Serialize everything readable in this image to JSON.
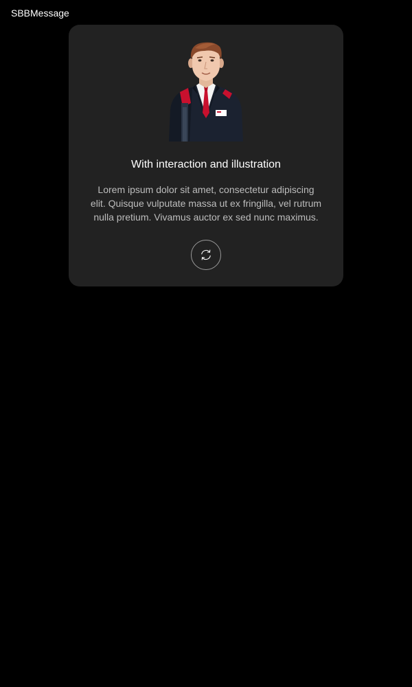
{
  "app": {
    "title": "SBBMessage"
  },
  "message": {
    "title": "With interaction and illustration",
    "body": "Lorem ipsum dolor sit amet, consectetur adipiscing elit. Quisque vulputate massa ut ex fringilla, vel rutrum nulla pretium. Vivamus auctor ex sed nunc maximus.",
    "illustration": "train-staff-person-illustration",
    "action_icon": "refresh-icon"
  },
  "colors": {
    "background": "#000000",
    "card": "#222222",
    "title_text": "#ffffff",
    "body_text": "#bdbdbd",
    "accent_red": "#c8102e"
  }
}
